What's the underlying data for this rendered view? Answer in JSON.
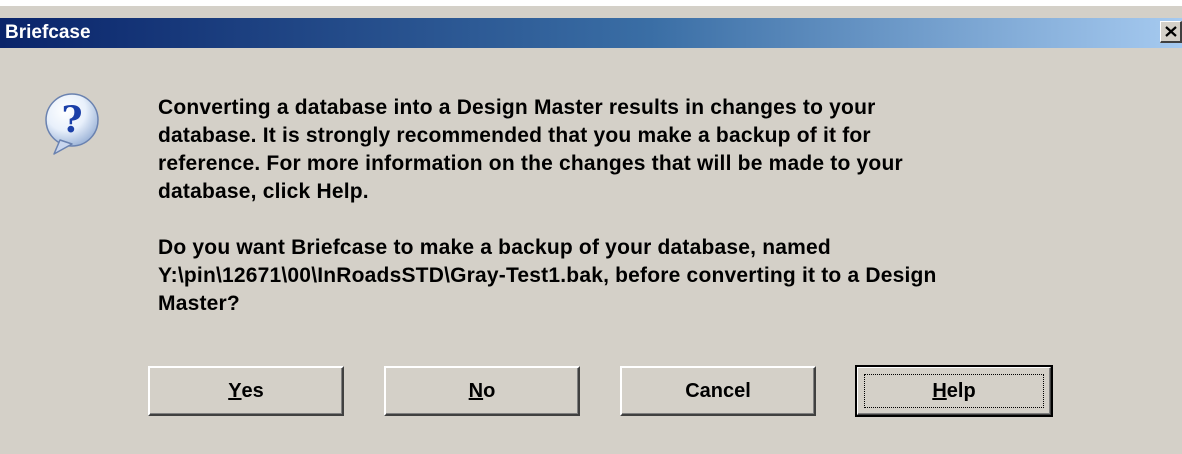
{
  "window": {
    "title": "Briefcase"
  },
  "message": {
    "paragraph1": "Converting a database into a Design Master results in changes to your\ndatabase. It is strongly recommended that you make a backup of it for\nreference. For more information on the changes that will be made to your\ndatabase, click Help.",
    "paragraph2": "Do you want Briefcase to make a backup of your database, named\nY:\\pin\\12671\\00\\InRoadsSTD\\Gray-Test1.bak, before converting it to a Design\nMaster?"
  },
  "buttons": {
    "yes": {
      "mnemonic": "Y",
      "rest": "es"
    },
    "no": {
      "mnemonic": "N",
      "rest": "o"
    },
    "cancel": {
      "label": "Cancel"
    },
    "help": {
      "mnemonic": "H",
      "rest": "elp"
    }
  },
  "icons": {
    "dialog_icon": "question-icon",
    "close": "close-icon"
  }
}
